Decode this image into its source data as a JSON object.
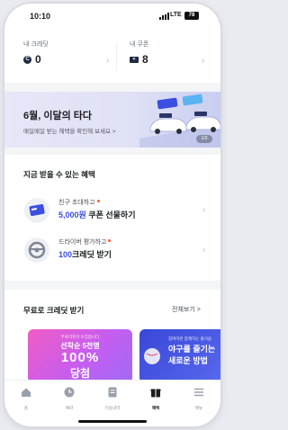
{
  "status_bar": {
    "time": "10:10",
    "network": "LTE",
    "battery": "78"
  },
  "wallet": {
    "credit": {
      "label": "내 크레딧",
      "value": "0",
      "icon": "credit-coin-icon"
    },
    "coupon": {
      "label": "내 쿠폰",
      "value": "8",
      "icon": "coupon-ticket-icon"
    }
  },
  "banner": {
    "title": "6월, 이달의 타다",
    "subtitle": "매일매일 받는 혜택을 확인해 보세요 >",
    "page_indicator": "1/3"
  },
  "benefits": {
    "title": "지금 받을 수 있는 혜택",
    "items": [
      {
        "line1": "친구 초대하고",
        "highlight": "5,000원",
        "line2_rest": " 쿠폰 선물하기",
        "icon": "coupon-card-icon"
      },
      {
        "line1": "드라이버 평가하고",
        "highlight": "100",
        "line2_rest": "크레딧 받기",
        "icon": "steering-wheel-icon"
      }
    ]
  },
  "free_credit": {
    "title": "무료로 크레딧 받기",
    "see_all": "전체보기 >",
    "cards": [
      {
        "small": "무료리뷰어 모집합니다",
        "line1": "선착순 5천명",
        "big": "100%",
        "line3": "당첨"
      },
      {
        "small": "참여하면 함께하는 즐거움",
        "line1": "야구를 즐기는",
        "line2": "새로운 방법"
      }
    ]
  },
  "tabbar": {
    "tabs": [
      {
        "label": "홈",
        "icon": "home-icon"
      },
      {
        "label": "예약",
        "icon": "clock-icon"
      },
      {
        "label": "이용내역",
        "icon": "receipt-icon"
      },
      {
        "label": "혜택",
        "icon": "gift-icon",
        "active": true
      },
      {
        "label": "메뉴",
        "icon": "menu-icon"
      }
    ]
  },
  "colors": {
    "accent": "#3d4fe0",
    "navy": "#1f2a44",
    "notify_dot": "#ff5a2a"
  }
}
